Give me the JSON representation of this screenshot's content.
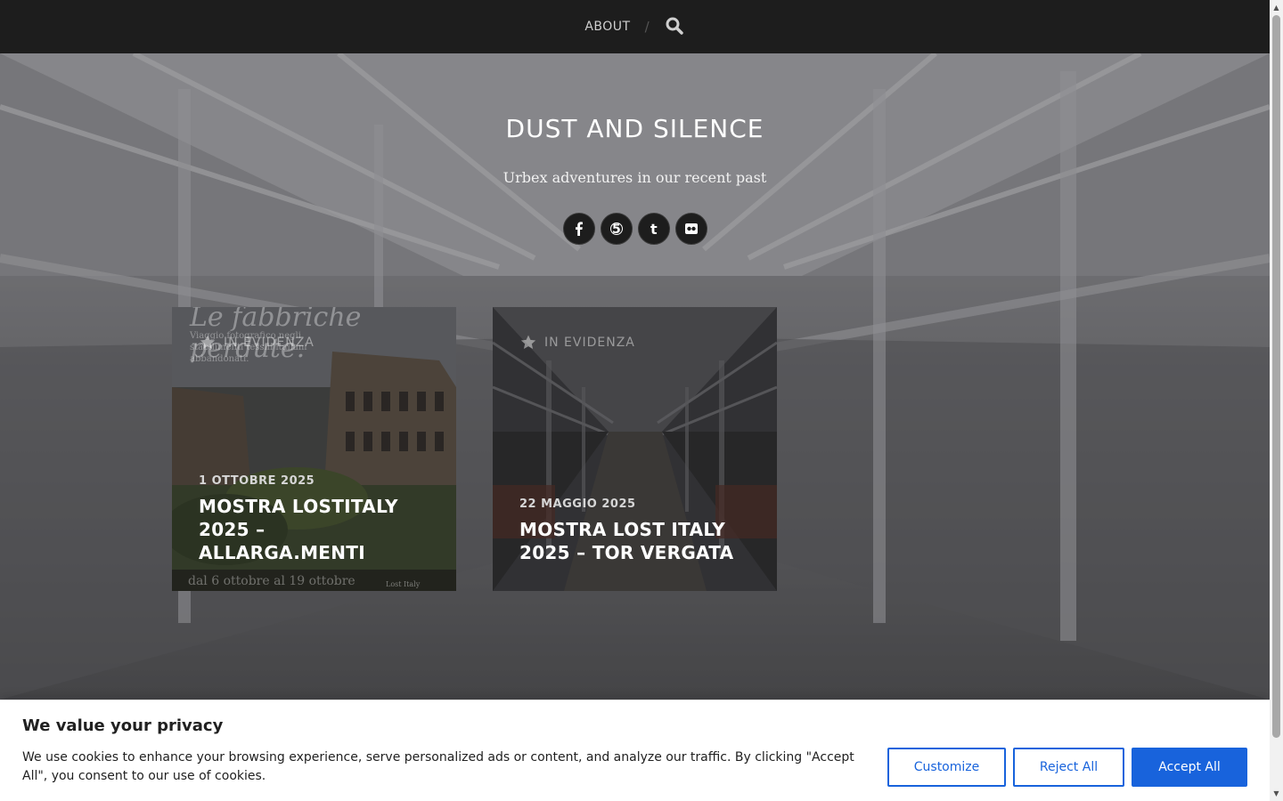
{
  "nav": {
    "about_label": "ABOUT",
    "separator": "/",
    "search_icon": "search-icon"
  },
  "hero": {
    "title": "DUST AND SILENCE",
    "tagline": "Urbex adventures in our recent past",
    "socials": [
      {
        "icon": "facebook-icon",
        "glyph": "f"
      },
      {
        "icon": "500px-icon",
        "glyph": "5"
      },
      {
        "icon": "tumblr-icon",
        "glyph": "t"
      },
      {
        "icon": "flickr-icon",
        "glyph": "••"
      }
    ]
  },
  "posts": [
    {
      "featured_label": "IN EVIDENZA",
      "date": "1 OTTOBRE 2025",
      "title": "MOSTRA LOSTITALY 2025 – ALLARGA.MENTI",
      "poster_headline": "Le fabbriche perdute.",
      "poster_subtitle": "Viaggio fotografico negli stabilimenti tessili italiani abbandonati.",
      "poster_footer": "dal 6 ottobre al 19 ottobre",
      "poster_brand": "Lost Italy"
    },
    {
      "featured_label": "IN EVIDENZA",
      "date": "22 MAGGIO 2025",
      "title": "MOSTRA LOST ITALY 2025 – TOR VERGATA"
    }
  ],
  "cookie": {
    "title": "We value your privacy",
    "text": "We use cookies to enhance your browsing experience, serve personalized ads or content, and analyze our traffic. By clicking \"Accept All\", you consent to our use of cookies.",
    "customize_label": "Customize",
    "reject_label": "Reject All",
    "accept_label": "Accept All"
  },
  "colors": {
    "topbar": "#1d1d1d",
    "accent": "#1863dc"
  }
}
